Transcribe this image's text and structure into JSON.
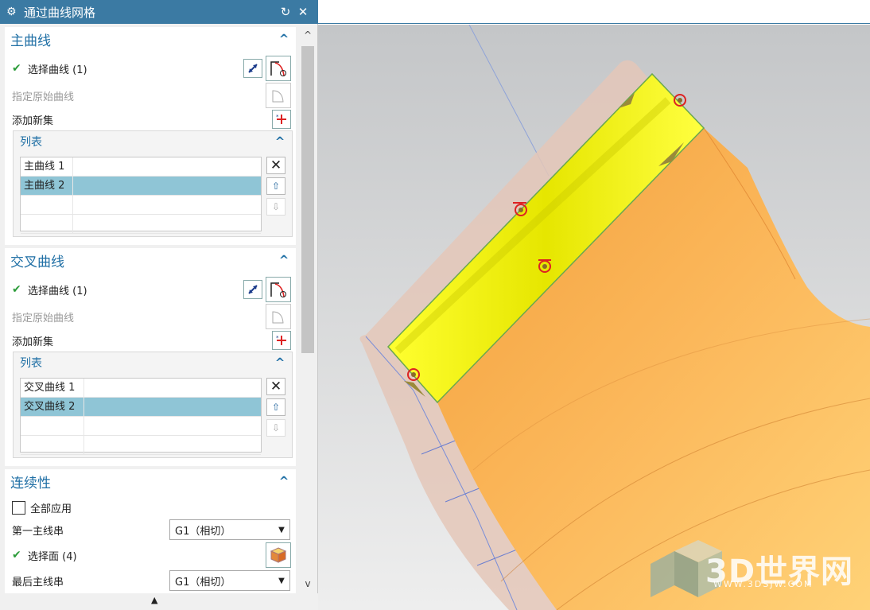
{
  "dialog": {
    "title": "通过曲线网格",
    "reset_icon": "reset-icon",
    "close_icon": "close-icon"
  },
  "primary_curves": {
    "title": "主曲线",
    "select_label": "选择曲线 (1)",
    "origin_label": "指定原始曲线",
    "add_set_label": "添加新集",
    "list_title": "列表",
    "items": [
      "主曲线 1",
      "主曲线 2"
    ],
    "selected_index": 1
  },
  "cross_curves": {
    "title": "交叉曲线",
    "select_label": "选择曲线 (1)",
    "origin_label": "指定原始曲线",
    "add_set_label": "添加新集",
    "list_title": "列表",
    "items": [
      "交叉曲线 1",
      "交叉曲线 2"
    ],
    "selected_index": 1
  },
  "continuity": {
    "title": "连续性",
    "apply_all_label": "全部应用",
    "apply_all_checked": false,
    "first_primary_label": "第一主线串",
    "first_primary_value": "G1（相切）",
    "select_face_label": "选择面 (4)",
    "last_primary_label": "最后主线串",
    "last_primary_value": "G1（相切）"
  },
  "watermark": {
    "text": "3D世界网",
    "url": "WWW.3DSJW.COM"
  },
  "colors": {
    "title_bar": "#3b7aa3",
    "section_title": "#1f6fa5",
    "selected_row": "#8fc5d6",
    "surface_highlight": "#ffff00",
    "surface_body": "#f7a94a"
  }
}
